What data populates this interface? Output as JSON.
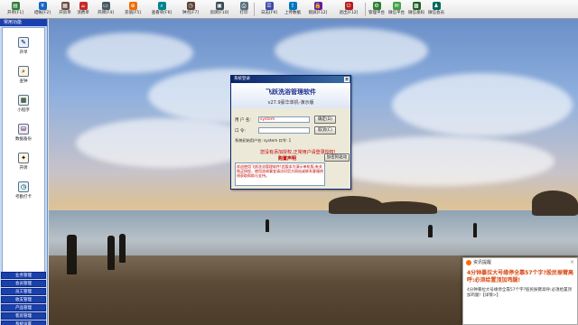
{
  "toolbar": {
    "items": [
      {
        "label": "开单[F1]",
        "icon": "open-order-icon",
        "color": "#2e7d32"
      },
      {
        "label": "结帐[F2]",
        "icon": "checkout-icon",
        "color": "#1565c0"
      },
      {
        "label": "开房单",
        "icon": "room-order-icon",
        "color": "#6d4c41"
      },
      {
        "label": "消费单",
        "icon": "consume-icon",
        "color": "#c62828"
      },
      {
        "label": "开牌[F4]",
        "icon": "card-icon",
        "color": "#455a64"
      },
      {
        "label": "充值[F5]",
        "icon": "recharge-icon",
        "color": "#ef6c00"
      },
      {
        "label": "查看单[F6]",
        "icon": "view-order-icon",
        "color": "#00838f"
      },
      {
        "label": "钟点[F7]",
        "icon": "clock-icon",
        "color": "#5d4037"
      },
      {
        "label": "房牌[F10]",
        "icon": "room-card-icon",
        "color": "#37474f"
      },
      {
        "label": "打印",
        "icon": "print-icon",
        "color": "#546e7a"
      },
      {
        "label": "日志[F9]",
        "icon": "log-icon",
        "color": "#3949ab"
      },
      {
        "label": "上传数据",
        "icon": "upload-icon",
        "color": "#0277bd"
      },
      {
        "label": "锁屏[F12]",
        "icon": "lock-icon",
        "color": "#6a1b9a"
      },
      {
        "label": "退出[F12]",
        "icon": "exit-icon",
        "color": "#b71c1c"
      },
      {
        "label": "管理平台",
        "icon": "manage-icon",
        "color": "#2e7d32"
      },
      {
        "label": "微信平台",
        "icon": "wechat-icon",
        "color": "#43a047"
      },
      {
        "label": "微信发码",
        "icon": "wechat-code-icon",
        "color": "#1b5e20"
      },
      {
        "label": "微信会员",
        "icon": "wechat-member-icon",
        "color": "#00695c"
      }
    ]
  },
  "sidebar": {
    "header": "常用功能",
    "items": [
      {
        "label": "开单",
        "icon": "open-order-icon",
        "glyph": "✎"
      },
      {
        "label": "查钟",
        "icon": "check-clock-icon",
        "glyph": "⌕"
      },
      {
        "label": "小程序",
        "icon": "mini-program-icon",
        "glyph": "▦"
      },
      {
        "label": "数据备份",
        "icon": "backup-icon",
        "glyph": "⛁"
      },
      {
        "label": "开牌",
        "icon": "card-icon",
        "glyph": "✦"
      },
      {
        "label": "考勤打卡",
        "icon": "attendance-icon",
        "glyph": "◷"
      }
    ],
    "bottom": [
      "业务管理",
      "会员管理",
      "员工管理",
      "收支管理",
      "产品管理",
      "客房管理",
      "系统设置"
    ]
  },
  "login": {
    "title": "系统登录",
    "app_name": "飞跃洗浴管理软件",
    "version": "v27.9豪华单机-演示版",
    "user_label": "用 户 名:",
    "user_value": "system",
    "password_label": "口      令:",
    "password_value": "",
    "login_button": "确定(D)",
    "cancel_button": "取消(C)",
    "tip": "系统初始用户名: system  口令: 1",
    "status": "您没有添加授权,正常用户请登录授权!",
    "notice_title": "购置声明",
    "notice_text": "欢迎使用飞跃洗浴管理软件!此版本为演示单机版,有关购买授权、使用咨询事宜请访问官方网站或联系客服热线获取帮助与支持。",
    "notice_button": "加密狗驱动"
  },
  "ad": {
    "source": "资讯提醒",
    "headline": "4分钟暴拉大号缘停全靠57个字?股民振臂高呼:必须给置顶加鸡腿!",
    "body": "4分钟暴拉大号缘停全靠57个字?股民振臂高呼:必须给置顶加鸡腿!【详情>】",
    "close": "×"
  }
}
